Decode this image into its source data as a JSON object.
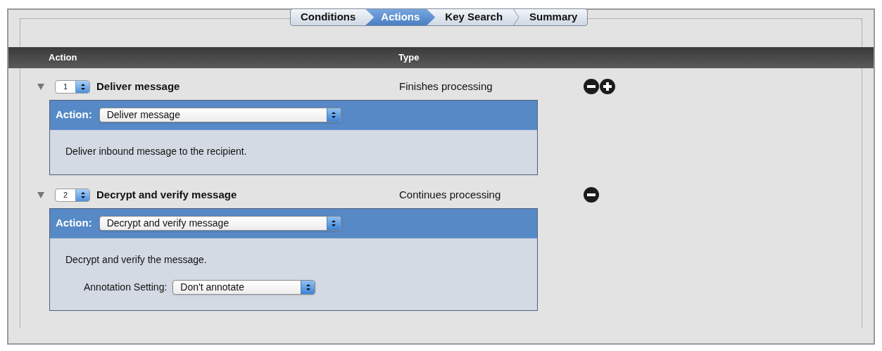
{
  "tabs": [
    {
      "label": "Conditions",
      "selected": false
    },
    {
      "label": "Actions",
      "selected": true
    },
    {
      "label": "Key Search",
      "selected": false
    },
    {
      "label": "Summary",
      "selected": false
    }
  ],
  "table": {
    "columns": [
      "Action",
      "Type"
    ],
    "rows": [
      {
        "expanded": true,
        "order": "1",
        "title": "Deliver message",
        "type": "Finishes processing",
        "add_button": true,
        "action_label": "Action:",
        "action_value": "Deliver message",
        "description": "Deliver inbound message to the recipient.",
        "settings": []
      },
      {
        "expanded": true,
        "order": "2",
        "title": "Decrypt and verify message",
        "type": "Continues processing",
        "add_button": false,
        "action_label": "Action:",
        "action_value": "Decrypt and verify message",
        "description": "Decrypt and verify the message.",
        "settings": [
          {
            "label": "Annotation Setting:",
            "value": "Don't annotate"
          }
        ]
      }
    ]
  }
}
